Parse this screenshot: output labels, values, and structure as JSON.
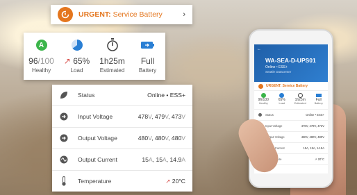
{
  "urgent": {
    "prefix": "URGENT:",
    "message": "Service Battery",
    "chevron": "›",
    "accent_color": "#e4761e",
    "icon": "alert-cycle-icon"
  },
  "stats": [
    {
      "key": "healthy",
      "icon": "health-badge-icon",
      "badge": "A",
      "value": "96",
      "suffix": "/100",
      "label": "Healthy",
      "color": "#3bb54a"
    },
    {
      "key": "load",
      "icon": "load-pie-icon",
      "arrow": "↗",
      "value": "65%",
      "label": "Load",
      "color": "#2a7fd4",
      "fraction": 0.65
    },
    {
      "key": "estimated",
      "icon": "stopwatch-icon",
      "value": "1h25m",
      "label": "Estimated"
    },
    {
      "key": "battery",
      "icon": "battery-icon",
      "value": "Full",
      "label": "Battery",
      "color": "#2a7fd4"
    }
  ],
  "details": [
    {
      "icon": "leaf-icon",
      "name": "Status",
      "value": "Online • ESS+"
    },
    {
      "icon": "input-arrow-icon",
      "name": "Input Voltage",
      "v1": "478",
      "v2": "479",
      "v3": "473",
      "unit": "V"
    },
    {
      "icon": "output-arrow-icon",
      "name": "Output Voltage",
      "v1": "480",
      "v2": "480",
      "v3": "480",
      "unit": "V"
    },
    {
      "icon": "current-wave-icon",
      "name": "Output Current",
      "v1": "15",
      "v2": "15",
      "v3": "14.9",
      "unit": "A"
    },
    {
      "icon": "thermometer-icon",
      "name": "Temperature",
      "arrow": "↗",
      "value": "20°C"
    }
  ],
  "phone": {
    "nav": "←",
    "device_name": "WA-SEA-D-UPS01",
    "status": "Online • ESS+",
    "location": "Seattle Datacenter",
    "urgent_text": "URGENT: Service Battery",
    "stats": [
      {
        "value": "96/100",
        "label": "Healthy"
      },
      {
        "value": "65%",
        "label": "Load"
      },
      {
        "value": "1h25m",
        "label": "Estimated"
      },
      {
        "value": "Full",
        "label": "Battery"
      }
    ],
    "rows": [
      {
        "name": "Status",
        "value": "Online • ESS+"
      },
      {
        "name": "Input Voltage",
        "value": "478V, 479V, 473V"
      },
      {
        "name": "Output Voltage",
        "value": "480V, 480V, 480V"
      },
      {
        "name": "Output Current",
        "value": "15A, 15A, 14.9A"
      },
      {
        "name": "Temperature",
        "value": "↗ 20°C"
      }
    ]
  }
}
